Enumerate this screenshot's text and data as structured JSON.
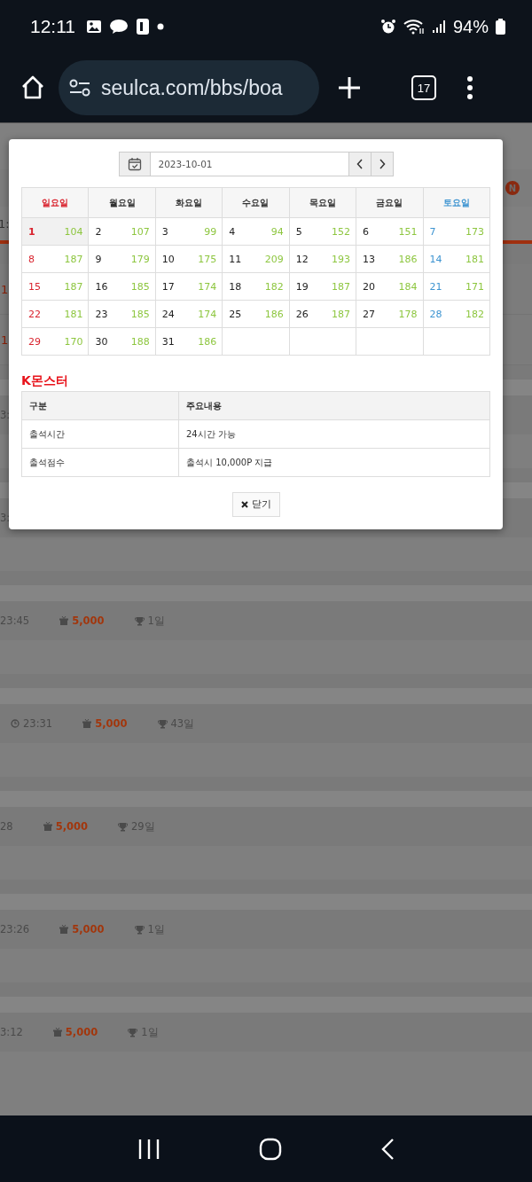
{
  "status_bar": {
    "time": "12:11",
    "battery": "94%"
  },
  "browser": {
    "url": "seulca.com/bbs/boa",
    "tab_count": "17"
  },
  "background_page": {
    "nav_badges": [
      "N"
    ],
    "fragment": "1:",
    "posts": [
      {
        "kind": "title",
        "title": "1"
      },
      {
        "kind": "title",
        "title": "1"
      },
      {
        "kind": "fragment",
        "time": "3:"
      },
      {
        "kind": "fragment",
        "time": "3:"
      },
      {
        "kind": "stats",
        "time": "23:45",
        "points": "5,000",
        "days": "1일"
      },
      {
        "kind": "stats_clock",
        "time": "23:31",
        "points": "5,000",
        "days": "43일"
      },
      {
        "kind": "stats",
        "time": "28",
        "points": "5,000",
        "days": "29일"
      },
      {
        "kind": "stats",
        "time": "23:26",
        "points": "5,000",
        "days": "1일"
      },
      {
        "kind": "stats",
        "time": "3:12",
        "points": "5,000",
        "days": "1일"
      }
    ]
  },
  "modal": {
    "date": "2023-10-01",
    "weekdays": [
      "일요일",
      "월요일",
      "화요일",
      "수요일",
      "목요일",
      "금요일",
      "토요일"
    ],
    "weeks": [
      [
        {
          "day": "1",
          "count": "104",
          "selected": true
        },
        {
          "day": "2",
          "count": "107",
          "selected": false
        },
        {
          "day": "3",
          "count": "99",
          "selected": false
        },
        {
          "day": "4",
          "count": "94",
          "selected": false
        },
        {
          "day": "5",
          "count": "152",
          "selected": false
        },
        {
          "day": "6",
          "count": "151",
          "selected": false
        },
        {
          "day": "7",
          "count": "173",
          "selected": false
        }
      ],
      [
        {
          "day": "8",
          "count": "187",
          "selected": false
        },
        {
          "day": "9",
          "count": "179",
          "selected": false
        },
        {
          "day": "10",
          "count": "175",
          "selected": false
        },
        {
          "day": "11",
          "count": "209",
          "selected": false
        },
        {
          "day": "12",
          "count": "193",
          "selected": false
        },
        {
          "day": "13",
          "count": "186",
          "selected": false
        },
        {
          "day": "14",
          "count": "181",
          "selected": false
        }
      ],
      [
        {
          "day": "15",
          "count": "187",
          "selected": false
        },
        {
          "day": "16",
          "count": "185",
          "selected": false
        },
        {
          "day": "17",
          "count": "174",
          "selected": false
        },
        {
          "day": "18",
          "count": "182",
          "selected": false
        },
        {
          "day": "19",
          "count": "187",
          "selected": false
        },
        {
          "day": "20",
          "count": "184",
          "selected": false
        },
        {
          "day": "21",
          "count": "171",
          "selected": false
        }
      ],
      [
        {
          "day": "22",
          "count": "181",
          "selected": false
        },
        {
          "day": "23",
          "count": "185",
          "selected": false
        },
        {
          "day": "24",
          "count": "174",
          "selected": false
        },
        {
          "day": "25",
          "count": "186",
          "selected": false
        },
        {
          "day": "26",
          "count": "187",
          "selected": false
        },
        {
          "day": "27",
          "count": "178",
          "selected": false
        },
        {
          "day": "28",
          "count": "182",
          "selected": false
        }
      ],
      [
        {
          "day": "29",
          "count": "170",
          "selected": false
        },
        {
          "day": "30",
          "count": "188",
          "selected": false
        },
        {
          "day": "31",
          "count": "186",
          "selected": false
        }
      ]
    ],
    "section_title": "K몬스터",
    "info_table": {
      "columns": [
        "구분",
        "주요내용"
      ],
      "rows": [
        [
          "출석시간",
          "24시간 가능"
        ],
        [
          "출석점수",
          "출석시 10,000P 지급"
        ]
      ]
    },
    "close_button": "닫기"
  }
}
